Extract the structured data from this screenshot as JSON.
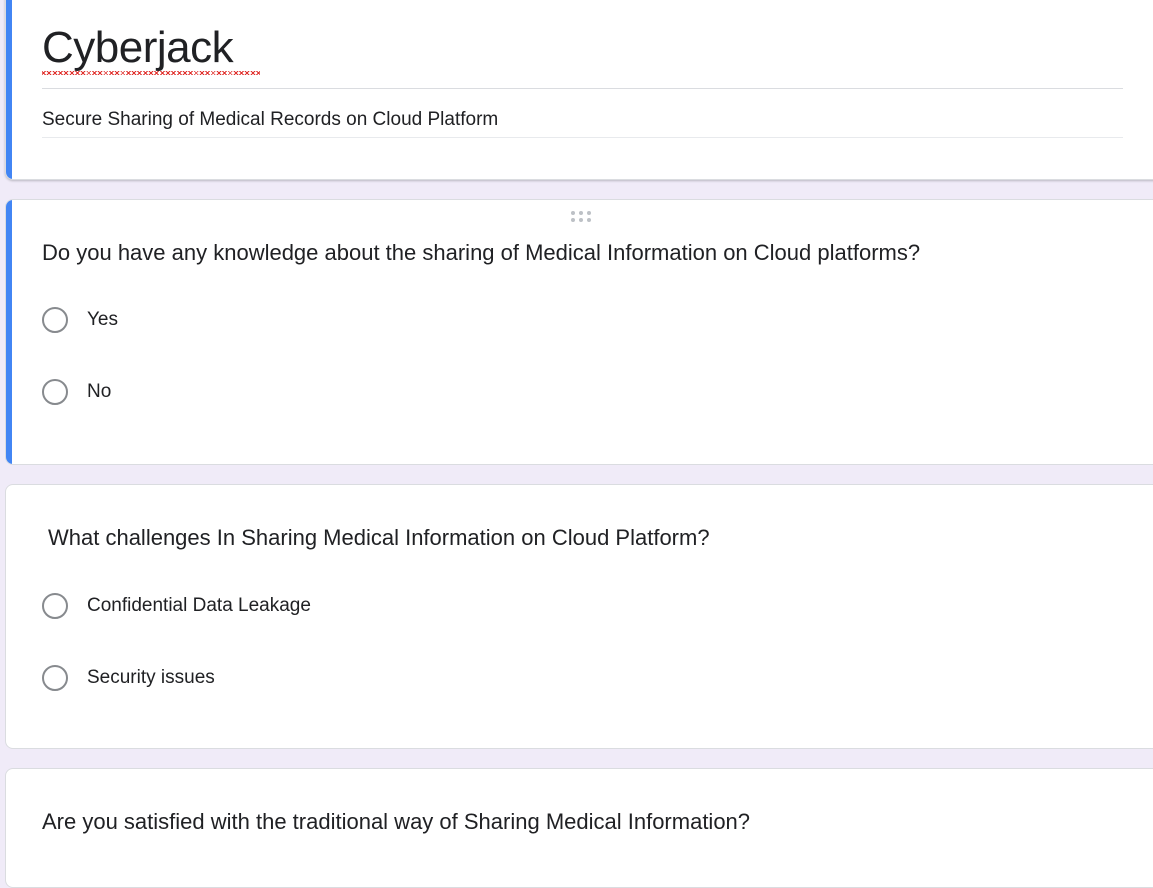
{
  "form": {
    "title": "Cyberjack",
    "description": "Secure Sharing of Medical Records on Cloud Platform"
  },
  "questions": [
    {
      "text": "Do you have any knowledge about the sharing of Medical Information on Cloud platforms?",
      "options": [
        "Yes",
        "No"
      ]
    },
    {
      "text": "What challenges In Sharing Medical Information on Cloud Platform?",
      "options": [
        "Confidential Data Leakage",
        "Security issues"
      ]
    },
    {
      "text": "Are you satisfied with the traditional way of Sharing Medical Information?",
      "options": []
    }
  ],
  "colors": {
    "accent": "#4285f4",
    "background": "#f0ebf8",
    "spellcheck": "#e0302c"
  },
  "icons": {
    "drag_handle": "drag-handle-icon",
    "radio": "radio-unchecked-icon"
  }
}
